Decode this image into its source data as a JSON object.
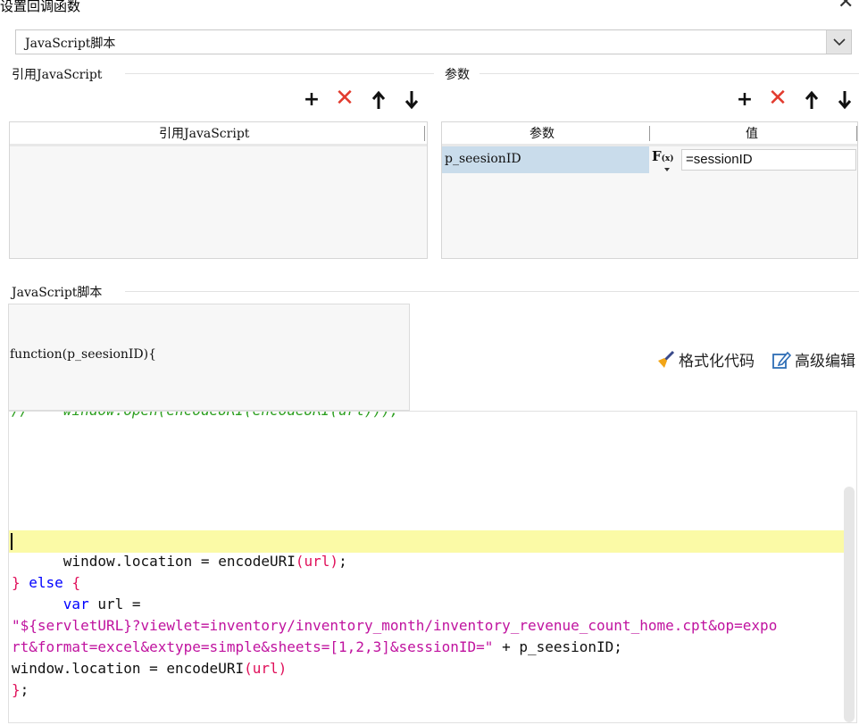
{
  "dialog": {
    "title": "设置回调函数",
    "close_glyph": "✕"
  },
  "type_select": {
    "value": "JavaScript脚本"
  },
  "ref_section": {
    "group_label": "引用JavaScript",
    "column_header": "引用JavaScript"
  },
  "params_section": {
    "group_label": "参数",
    "headers": [
      "参数",
      "值"
    ],
    "rows": [
      {
        "name": "p_seesionID",
        "value": "=sessionID"
      }
    ],
    "fx_label": "F",
    "fx_sub": "(x)"
  },
  "toolbar": {
    "add": "+",
    "remove": "✕",
    "up": "🡑",
    "down": "🡓"
  },
  "script_section": {
    "group_label": "JavaScript脚本",
    "signature": "function(p_seesionID){",
    "format_label": "格式化代码",
    "advanced_label": "高级编辑"
  },
  "editor": {
    "cut_comment": "//    window.open(encodeURI(encodeURI(url)));",
    "line_window1_a": "      window.location = encodeURI",
    "line_window1_b": "(url)",
    "line_window1_c": ";",
    "else_brace1": "}",
    "else_kw": " else ",
    "else_brace2": "{",
    "var_indent": "      ",
    "var_kw": "var",
    "var_rest": " url =",
    "url_line1": "\"${servletURL}?viewlet=inventory/inventory_month/inventory_revenue_count_home.cpt&op=expo",
    "url_line2_str": "rt&format=excel&extype=simple&sheets=[1,2,3]&sessionID=\"",
    "url_line2_rest": " + p_seesionID;",
    "line_window2_a": "window.location = encodeURI",
    "line_window2_b": "(url)",
    "closing_brace": "}",
    "closing_semicolon": ";"
  },
  "colors": {
    "keyword": "#0000ff",
    "string": "#c0139f",
    "bracket": "#e0105a",
    "comment": "#2c9f1f",
    "highlight": "#fbfaa6",
    "selected_row": "#c9dceb",
    "delete": "#e23b2e"
  },
  "icons": [
    "close-icon",
    "chevron-down-icon",
    "add-icon",
    "delete-icon",
    "arrow-up-icon",
    "arrow-down-icon",
    "broom-icon",
    "edit-icon"
  ]
}
